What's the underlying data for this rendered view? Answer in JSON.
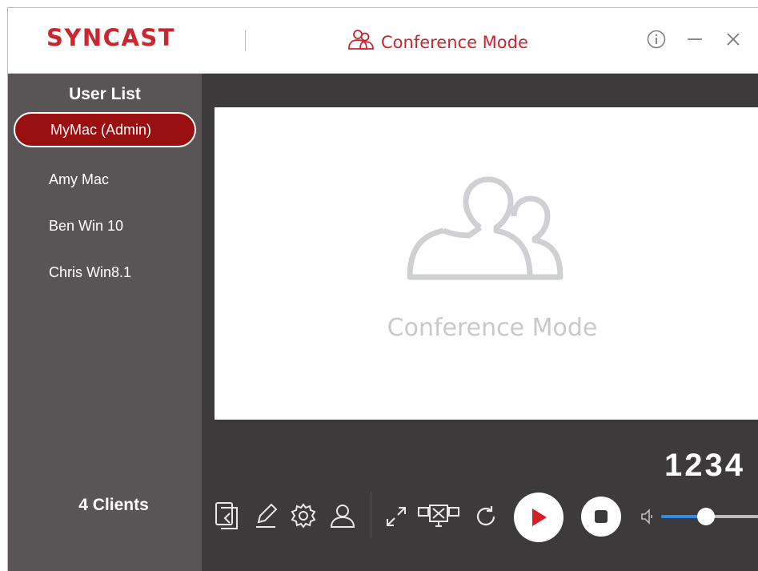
{
  "app": {
    "brand": "SYNCAST",
    "mode_title": "Conference Mode",
    "brand_color": "#c9272d"
  },
  "window_controls": [
    {
      "icon": "info-icon"
    },
    {
      "icon": "minimize-icon"
    },
    {
      "icon": "close-icon"
    }
  ],
  "sidebar": {
    "title": "User List",
    "users": [
      {
        "label": "MyMac (Admin)",
        "active": true
      },
      {
        "label": "Amy Mac",
        "active": false
      },
      {
        "label": "Ben Win 10",
        "active": false
      },
      {
        "label": "Chris Win8.1",
        "active": false
      }
    ],
    "clients_label": "4 Clients",
    "active_color": "#9a1010"
  },
  "preview": {
    "label": "Conference Mode",
    "icon": "users-icon"
  },
  "pin_code": "1234",
  "toolbar": {
    "icons": [
      "share-screen-icon",
      "pen-icon",
      "gear-icon",
      "user-icon",
      "fullscreen-icon",
      "no-display-icon",
      "refresh-icon",
      "play-icon",
      "stop-icon",
      "speaker-icon"
    ]
  },
  "volume": {
    "level": 0.46,
    "accent_color": "#2f8be6"
  }
}
